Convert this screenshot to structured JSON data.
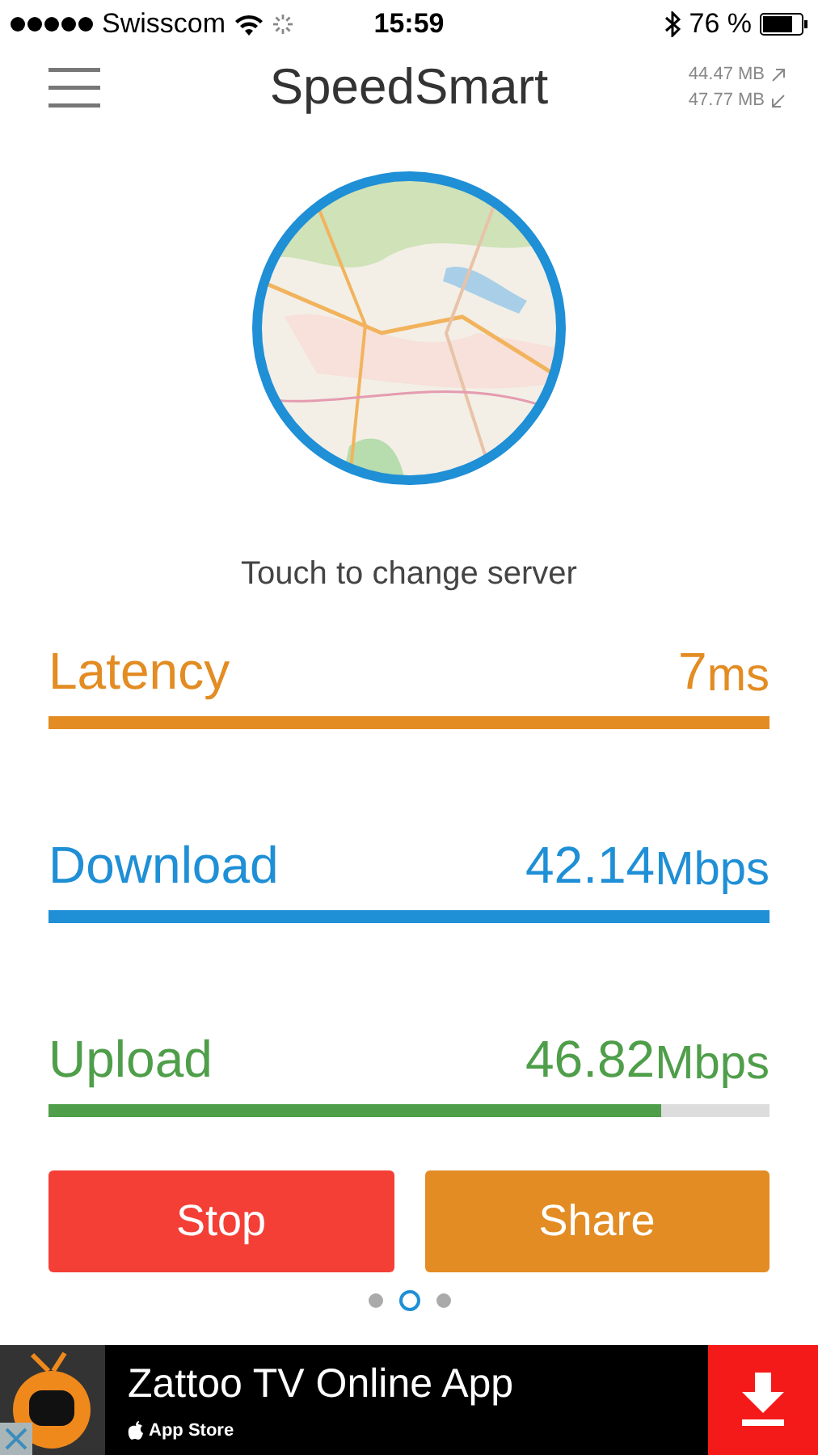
{
  "status_bar": {
    "carrier": "Swisscom",
    "time": "15:59",
    "battery": "76 %"
  },
  "header": {
    "title": "SpeedSmart",
    "uploaded": "44.47 MB",
    "downloaded": "47.77 MB"
  },
  "server": {
    "kind": "picture",
    "caption": "Touch to change server"
  },
  "metrics": [
    {
      "label": "Latency",
      "value": "7",
      "unit": "ms",
      "color": "#e38c23",
      "level": 1
    },
    {
      "label": "Download",
      "value": "42.14",
      "unit": "Mbps",
      "color": "#1f8fd6",
      "level": 1
    },
    {
      "label": "Upload",
      "value": "46.82",
      "unit": "Mbps",
      "color": "#4f9e4a",
      "level": 0.85
    }
  ],
  "buttons": [
    {
      "label": "Stop",
      "color": "#f43f37"
    },
    {
      "label": "Share",
      "color": "#e38c23"
    }
  ],
  "pages": [
    {
      "selected": false
    },
    {
      "selected": true
    },
    {
      "selected": false
    }
  ],
  "ad": {
    "title": "Zattoo TV Online App",
    "store": "App Store"
  }
}
